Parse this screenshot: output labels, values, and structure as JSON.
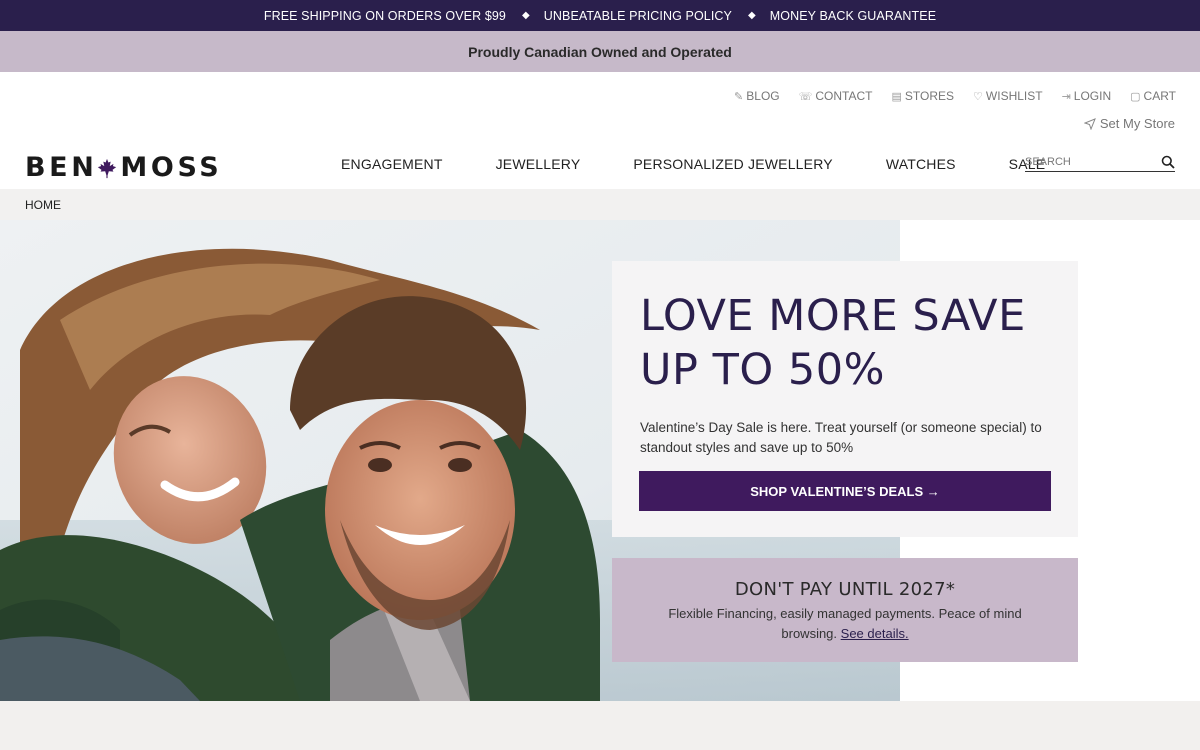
{
  "topbar": {
    "promos": [
      "FREE SHIPPING ON ORDERS OVER $99",
      "UNBEATABLE PRICING POLICY",
      "MONEY BACK GUARANTEE"
    ]
  },
  "banner": {
    "text": "Proudly Canadian Owned and Operated"
  },
  "utility_nav": {
    "blog": "BLOG",
    "contact": "CONTACT",
    "stores": "STORES",
    "wishlist": "WISHLIST",
    "login": "LOGIN",
    "cart": "CART",
    "set_store": "Set My Store"
  },
  "logo": {
    "left": "BEN",
    "right": "MOSS"
  },
  "nav": {
    "items": [
      "ENGAGEMENT",
      "JEWELLERY",
      "PERSONALIZED JEWELLERY",
      "WATCHES",
      "SALE"
    ]
  },
  "search": {
    "placeholder": "SEARCH"
  },
  "breadcrumb": {
    "home": "HOME"
  },
  "hero": {
    "heading_line1": "LOVE MORE SAVE",
    "heading_line2": "UP TO 50%",
    "body": "Valentine’s Day Sale is here. Treat yourself (or someone special) to standout styles and save up to 50%",
    "cta": "SHOP VALENTINE’S DEALS →"
  },
  "financing": {
    "heading": "DON'T PAY UNTIL 2027*",
    "line1": "Flexible Financing, easily managed payments. Peace of mind",
    "line2_prefix": "browsing.",
    "link": "See details."
  },
  "colors": {
    "topbar_bg": "#2a1f4c",
    "banner_bg": "#c6b9c9",
    "cta_bg": "#3f1a5e",
    "finance_bg": "#c8b8ca",
    "maple_leaf": "#3f1a5e"
  }
}
